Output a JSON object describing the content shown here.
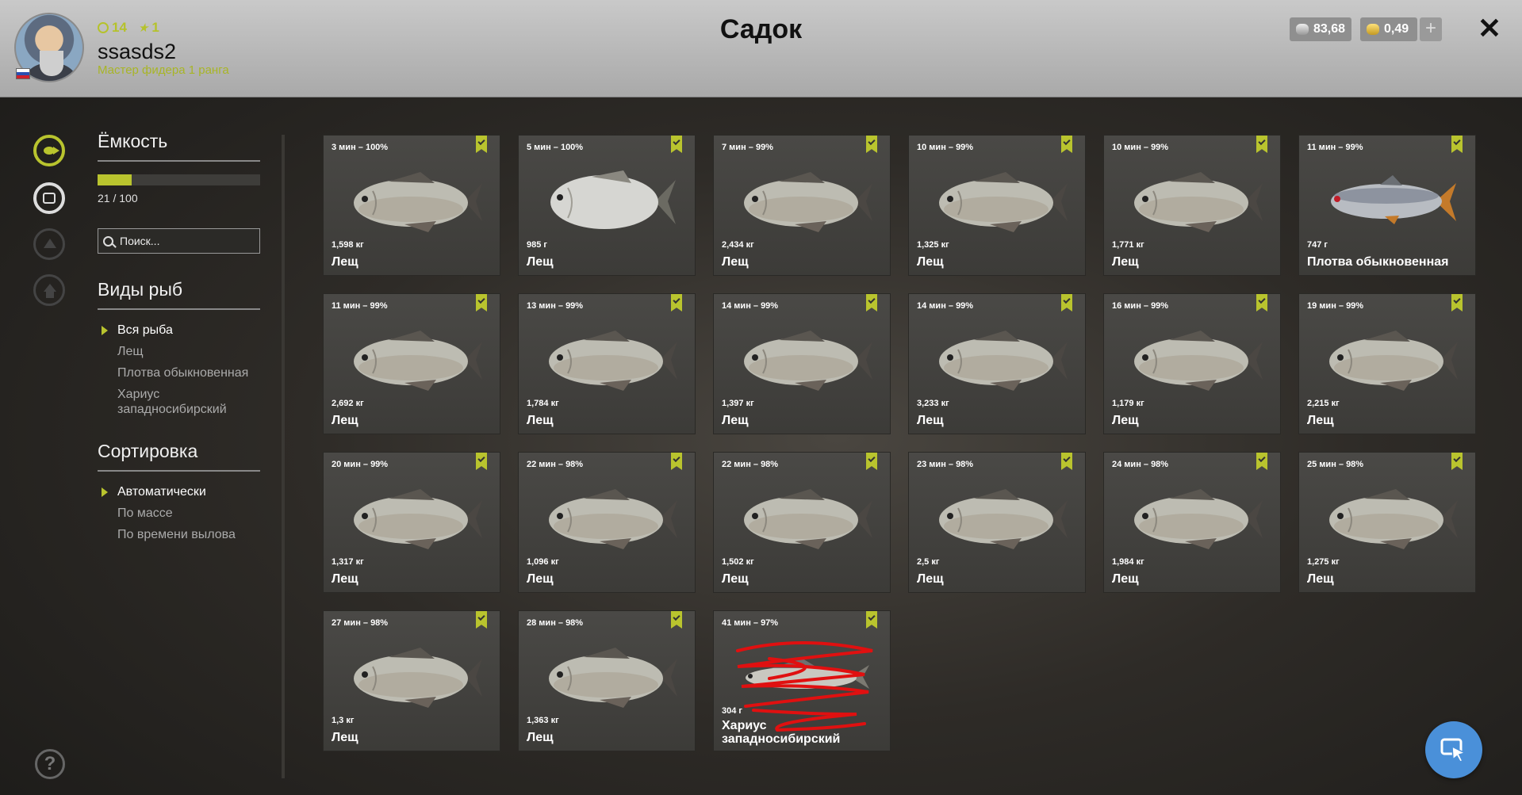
{
  "header": {
    "title": "Садок",
    "player": {
      "name": "ssasds2",
      "rank": "Мастер фидера 1 ранга",
      "level": "14",
      "stars": "1"
    },
    "currency": {
      "silver": "83,68",
      "gold": "0,49"
    },
    "plus_label": "+",
    "close_label": "✕"
  },
  "sidebar": {
    "capacity": {
      "title": "Ёмкость",
      "value": 21,
      "max": 100,
      "text": "21 / 100"
    },
    "search": {
      "placeholder": "Поиск..."
    },
    "species": {
      "title": "Виды рыб",
      "items": [
        "Вся рыба",
        "Лещ",
        "Плотва обыкновенная",
        "Хариус западносибирский"
      ],
      "selected": 0
    },
    "sort": {
      "title": "Сортировка",
      "items": [
        "Автоматически",
        "По массе",
        "По времени вылова"
      ],
      "selected": 0
    },
    "help_label": "?"
  },
  "fish": [
    {
      "time": "3 мин – 100%",
      "weight": "1,598 кг",
      "name": "Лещ",
      "kind": "bream"
    },
    {
      "time": "5 мин – 100%",
      "weight": "985 г",
      "name": "Лещ",
      "kind": "bream-light"
    },
    {
      "time": "7 мин – 99%",
      "weight": "2,434 кг",
      "name": "Лещ",
      "kind": "bream"
    },
    {
      "time": "10 мин – 99%",
      "weight": "1,325 кг",
      "name": "Лещ",
      "kind": "bream"
    },
    {
      "time": "10 мин – 99%",
      "weight": "1,771 кг",
      "name": "Лещ",
      "kind": "bream"
    },
    {
      "time": "11 мин – 99%",
      "weight": "747 г",
      "name": "Плотва обыкновенная",
      "kind": "roach"
    },
    {
      "time": "11 мин – 99%",
      "weight": "2,692 кг",
      "name": "Лещ",
      "kind": "bream"
    },
    {
      "time": "13 мин – 99%",
      "weight": "1,784 кг",
      "name": "Лещ",
      "kind": "bream"
    },
    {
      "time": "14 мин – 99%",
      "weight": "1,397 кг",
      "name": "Лещ",
      "kind": "bream"
    },
    {
      "time": "14 мин – 99%",
      "weight": "3,233 кг",
      "name": "Лещ",
      "kind": "bream"
    },
    {
      "time": "16 мин – 99%",
      "weight": "1,179 кг",
      "name": "Лещ",
      "kind": "bream"
    },
    {
      "time": "19 мин – 99%",
      "weight": "2,215 кг",
      "name": "Лещ",
      "kind": "bream"
    },
    {
      "time": "20 мин – 99%",
      "weight": "1,317 кг",
      "name": "Лещ",
      "kind": "bream"
    },
    {
      "time": "22 мин – 98%",
      "weight": "1,096 кг",
      "name": "Лещ",
      "kind": "bream"
    },
    {
      "time": "22 мин – 98%",
      "weight": "1,502 кг",
      "name": "Лещ",
      "kind": "bream"
    },
    {
      "time": "23 мин – 98%",
      "weight": "2,5 кг",
      "name": "Лещ",
      "kind": "bream"
    },
    {
      "time": "24 мин – 98%",
      "weight": "1,984 кг",
      "name": "Лещ",
      "kind": "bream"
    },
    {
      "time": "25 мин – 98%",
      "weight": "1,275 кг",
      "name": "Лещ",
      "kind": "bream"
    },
    {
      "time": "27 мин – 98%",
      "weight": "1,3 кг",
      "name": "Лещ",
      "kind": "bream"
    },
    {
      "time": "28 мин – 98%",
      "weight": "1,363 кг",
      "name": "Лещ",
      "kind": "bream"
    },
    {
      "time": "41 мин – 97%",
      "weight": "304 г",
      "name": "Хариус западносибирский",
      "kind": "grayling",
      "scribbled": true
    }
  ],
  "colors": {
    "accent": "#b9c42e",
    "header_bg": "#b5b5b5",
    "card_bg": "#454441",
    "cursor_button": "#4a90d9",
    "scribble": "#e01010"
  }
}
